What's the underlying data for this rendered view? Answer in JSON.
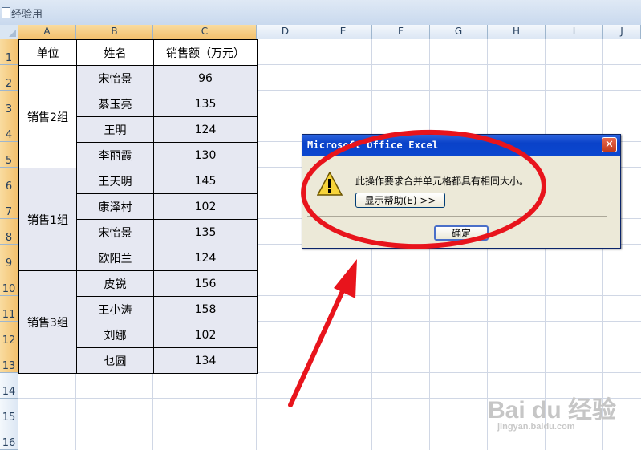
{
  "window": {
    "title": "经验用"
  },
  "columns": [
    "A",
    "B",
    "C",
    "D",
    "E",
    "F",
    "G",
    "H",
    "I",
    "J"
  ],
  "rows": [
    "1",
    "2",
    "3",
    "4",
    "5",
    "6",
    "7",
    "8",
    "9",
    "10",
    "11",
    "12",
    "13",
    "14",
    "15",
    "16"
  ],
  "table": {
    "headers": [
      "单位",
      "姓名",
      "销售额（万元）"
    ],
    "groups": [
      "销售2组",
      "销售1组",
      "销售3组"
    ],
    "records": [
      {
        "name": "宋怡景",
        "sales": "96"
      },
      {
        "name": "綦玉亮",
        "sales": "135"
      },
      {
        "name": "王明",
        "sales": "124"
      },
      {
        "name": "李丽霞",
        "sales": "130"
      },
      {
        "name": "王天明",
        "sales": "145"
      },
      {
        "name": "康泽村",
        "sales": "102"
      },
      {
        "name": "宋怡景",
        "sales": "135"
      },
      {
        "name": "欧阳兰",
        "sales": "124"
      },
      {
        "name": "皮锐",
        "sales": "156"
      },
      {
        "name": "王小涛",
        "sales": "158"
      },
      {
        "name": "刘娜",
        "sales": "102"
      },
      {
        "name": "乜圆",
        "sales": "134"
      }
    ]
  },
  "dialog": {
    "title": "Microsoft Office Excel",
    "message": "此操作要求合并单元格都具有相同大小。",
    "help_button": "显示帮助(E) >>",
    "ok_button": "确定",
    "close_symbol": "✕"
  },
  "watermark": {
    "brand": "Bai du 经验",
    "url": "jingyan.baidu.com"
  },
  "colors": {
    "annotation": "#e8141c",
    "selection": "#e6e8f2",
    "header_selected": "#f3c16e"
  }
}
